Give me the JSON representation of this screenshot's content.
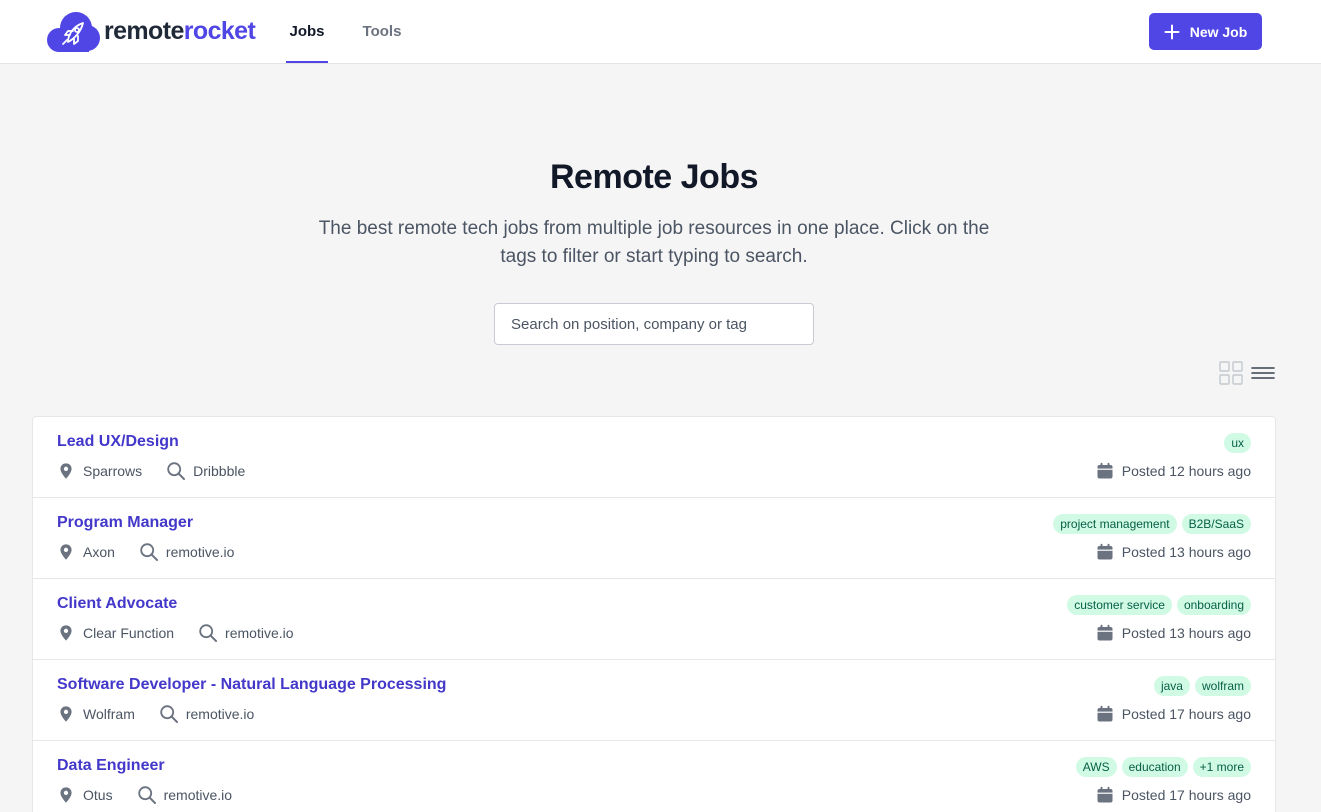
{
  "brand": {
    "part1": "remote",
    "part2": "rocket"
  },
  "nav": {
    "jobs": "Jobs",
    "tools": "Tools"
  },
  "new_job_label": "New Job",
  "hero": {
    "title": "Remote Jobs",
    "subtitle": "The best remote tech jobs from multiple job resources in one place. Click on the tags to filter or start typing to search."
  },
  "search": {
    "placeholder": "Search on position, company or tag",
    "value": ""
  },
  "view_toggle": {
    "options": [
      "grid-icon",
      "list-icon"
    ],
    "selected": "list-icon"
  },
  "colors": {
    "accent": "#4f46e5",
    "link": "#4338ca",
    "tag_bg": "#d1fae5",
    "tag_text": "#065f46"
  },
  "jobs": [
    {
      "title": "Lead UX/Design",
      "company": "Sparrows",
      "source": "Dribbble",
      "tags": [
        "ux"
      ],
      "posted": "Posted 12 hours ago"
    },
    {
      "title": "Program Manager",
      "company": "Axon",
      "source": "remotive.io",
      "tags": [
        "project management",
        "B2B/SaaS"
      ],
      "posted": "Posted 13 hours ago"
    },
    {
      "title": "Client Advocate",
      "company": "Clear Function",
      "source": "remotive.io",
      "tags": [
        "customer service",
        "onboarding"
      ],
      "posted": "Posted 13 hours ago"
    },
    {
      "title": "Software Developer - Natural Language Processing",
      "company": "Wolfram",
      "source": "remotive.io",
      "tags": [
        "java",
        "wolfram"
      ],
      "posted": "Posted 17 hours ago"
    },
    {
      "title": "Data Engineer",
      "company": "Otus",
      "source": "remotive.io",
      "tags": [
        "AWS",
        "education",
        "+1 more"
      ],
      "posted": "Posted 17 hours ago"
    }
  ]
}
